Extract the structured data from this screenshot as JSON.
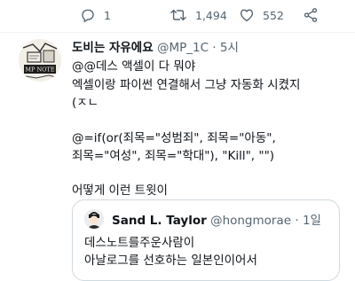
{
  "tweet_actions": {
    "reply_count": "1",
    "retweet_count": "1,494",
    "like_count": "552",
    "reply_icon": "reply-icon",
    "retweet_icon": "retweet-icon",
    "like_icon": "heart-icon",
    "share_icon": "share-icon"
  },
  "reply_tweet": {
    "avatar_text": "MP NOTE",
    "display_name": "도비는 자유에요",
    "handle": "@MP_1C",
    "separator": "·",
    "time": "5시",
    "lines": [
      "@@데스 액셀이 다 뭐야",
      "엑셀이랑 파이썬 연결해서 그냥 자동화 시켰지",
      "(ㅈㄴ",
      "",
      "@=if(or(죄목=\"성범죄\", 죄목=\"아동\",",
      "죄목=\"여성\", 죄목=\"학대\"), \"Kill\", \"\")",
      "",
      "어떻게 이런 트윗이"
    ]
  },
  "quoted_tweet": {
    "display_name": "Sand L. Taylor",
    "handle": "@hongmorae",
    "separator": "·",
    "time": "1일",
    "lines": [
      "데스노트를주운사람이",
      "아날로그를 선호하는 일본인이어서"
    ]
  },
  "colors": {
    "text": "#0f1419",
    "secondary": "#536471",
    "border": "#cfd9de"
  }
}
